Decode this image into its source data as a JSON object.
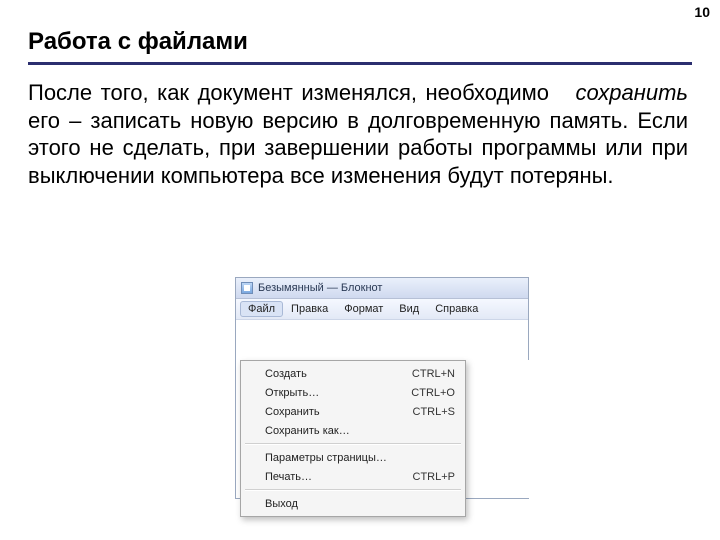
{
  "page_number": "10",
  "title": "Работа с файлами",
  "body_pre": "После того, как документ изменялся, необходимо ",
  "body_em": "сохранить",
  "body_post": " его – записать новую версию в долговременную память. Если этого не сделать, при завершении работы программы или при выключении компьютера все изменения будут потеряны.",
  "notepad": {
    "title": "Безымянный — Блокнот",
    "menus": [
      "Файл",
      "Правка",
      "Формат",
      "Вид",
      "Справка"
    ],
    "file_menu": [
      {
        "label": "Создать",
        "shortcut": "CTRL+N"
      },
      {
        "label": "Открыть…",
        "shortcut": "CTRL+O"
      },
      {
        "label": "Сохранить",
        "shortcut": "CTRL+S"
      },
      {
        "label": "Сохранить как…",
        "shortcut": ""
      },
      {
        "sep": true
      },
      {
        "label": "Параметры страницы…",
        "shortcut": ""
      },
      {
        "label": "Печать…",
        "shortcut": "CTRL+P"
      },
      {
        "sep": true
      },
      {
        "label": "Выход",
        "shortcut": ""
      }
    ]
  }
}
